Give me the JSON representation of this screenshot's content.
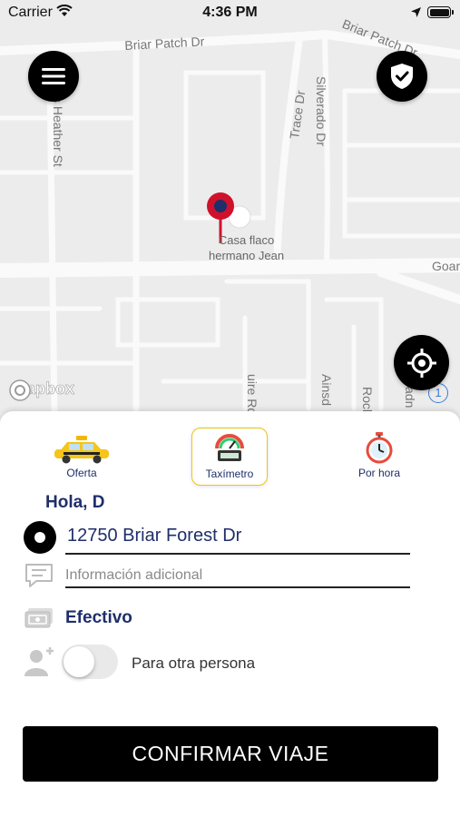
{
  "status_bar": {
    "carrier": "Carrier",
    "time": "4:36 PM"
  },
  "map": {
    "streets": [
      "Briar Patch Dr",
      "Briar Patch Dr",
      "Trace Dr",
      "Silverado Dr",
      "s Heather St",
      "Goar",
      "uire Rd",
      "Ainsd",
      "Rock",
      "adn"
    ],
    "place_label": [
      "Casa flaco",
      "hermano Jean"
    ],
    "attribution": "mapbox",
    "info_badge": "1",
    "pin_color": "#d0112b"
  },
  "modes": [
    {
      "label": "Oferta",
      "icon": "taxi-icon",
      "selected": false
    },
    {
      "label": "Taxímetro",
      "icon": "taximeter-icon",
      "selected": true
    },
    {
      "label": "Por hora",
      "icon": "stopwatch-icon",
      "selected": false
    }
  ],
  "greeting": "Hola, D",
  "pickup": {
    "address": "12750 Briar Forest Dr"
  },
  "extra_info": {
    "placeholder": "Información adicional"
  },
  "payment": {
    "method": "Efectivo"
  },
  "other_person": {
    "label": "Para otra persona",
    "enabled": false
  },
  "confirm_button": {
    "label": "CONFIRMAR VIAJE"
  },
  "colors": {
    "accent": "#f0c21a",
    "text_primary": "#1f2f6a",
    "button": "#000000"
  }
}
